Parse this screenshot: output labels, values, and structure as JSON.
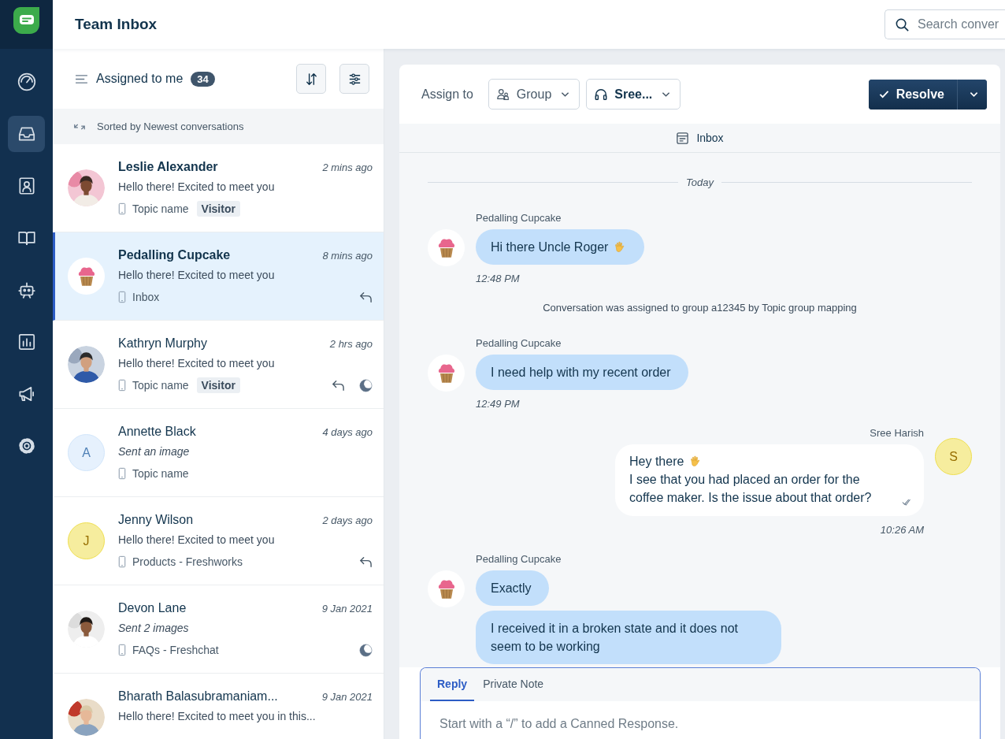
{
  "header": {
    "title": "Team Inbox",
    "search": {
      "placeholder": "Search conver"
    }
  },
  "nav": [
    {
      "selected": false
    },
    {
      "selected": true
    },
    {
      "selected": false
    },
    {
      "selected": false
    },
    {
      "selected": false
    },
    {
      "selected": false
    },
    {
      "selected": false
    },
    {
      "selected": false
    }
  ],
  "list": {
    "title": "Assigned to me",
    "count": "34",
    "sort_label": "Sorted by Newest conversations",
    "conversations": [
      {
        "name": "Leslie Alexander",
        "unread": true,
        "selected": false,
        "time": "2 mins ago",
        "preview": "Hello there! Excited to meet you",
        "preview_italic": false,
        "topic": "Topic name",
        "tag": "Visitor",
        "replied": false,
        "snoozed": false
      },
      {
        "name": "Pedalling Cupcake",
        "unread": true,
        "selected": true,
        "avatar": {
          "kind": "cupcake"
        },
        "time": "8 mins ago",
        "preview": "Hello there! Excited to meet you",
        "preview_italic": false,
        "topic": "Inbox",
        "replied": true,
        "snoozed": false
      },
      {
        "name": "Kathryn Murphy",
        "unread": false,
        "selected": false,
        "time": "2 hrs ago",
        "preview": "Hello there! Excited to meet you",
        "preview_italic": false,
        "topic": "Topic name",
        "tag": "Visitor",
        "replied": true,
        "snoozed": true
      },
      {
        "name": "Annette Black",
        "unread": false,
        "selected": false,
        "avatar": {
          "kind": "initial",
          "letter": "A",
          "color": "#e6f1fd"
        },
        "time": "4 days ago",
        "preview": "Sent an image",
        "preview_italic": true,
        "topic": "Topic name",
        "replied": false,
        "snoozed": false
      },
      {
        "name": "Jenny Wilson",
        "unread": false,
        "selected": false,
        "avatar": {
          "kind": "initial",
          "letter": "J",
          "color": "#f6ed9e"
        },
        "time": "2 days ago",
        "preview": "Hello there! Excited to meet you",
        "preview_italic": false,
        "topic": "Products - Freshworks",
        "replied": true,
        "snoozed": false
      },
      {
        "name": "Devon Lane",
        "unread": false,
        "selected": false,
        "time": "9 Jan 2021",
        "preview": "Sent 2 images",
        "preview_italic": true,
        "topic": "FAQs - Freshchat",
        "replied": false,
        "snoozed": true
      },
      {
        "name": "Bharath Balasubramaniam...",
        "unread": false,
        "selected": false,
        "time": "9 Jan 2021",
        "preview": "Hello there! Excited to meet you in this...",
        "preview_italic": false,
        "replied": false,
        "snoozed": false
      }
    ]
  },
  "chat": {
    "assign_label": "Assign to",
    "group": "Group",
    "agent": "Sree...",
    "resolve": "Resolve",
    "channel": "Inbox",
    "messages": [
      {
        "kind": "divider",
        "text": "Today"
      },
      {
        "kind": "incoming",
        "sender": "Pedalling Cupcake",
        "avatar": {
          "kind": "cupcake"
        },
        "bubbles": [
          {
            "text": "Hi there Uncle Roger",
            "wave": true
          }
        ],
        "time": "12:48 PM"
      },
      {
        "kind": "system",
        "text": "Conversation was assigned to group a12345 by Topic group mapping"
      },
      {
        "kind": "incoming",
        "sender": "Pedalling Cupcake",
        "avatar": {
          "kind": "cupcake"
        },
        "bubbles": [
          {
            "text": "I need help with my recent order",
            "wave": false
          }
        ],
        "time": "12:49 PM"
      },
      {
        "kind": "outgoing",
        "sender": "Sree Harish",
        "avatar": {
          "kind": "initial",
          "letter": "S",
          "color": "#f6ed9e"
        },
        "lines": [
          {
            "text": "Hey there",
            "wave": true
          },
          {
            "text": "I see that you had placed an order for the coffee maker. Is the issue about that order?",
            "wave": false
          }
        ],
        "read": true,
        "time": "10:26 AM"
      },
      {
        "kind": "incoming",
        "sender": "Pedalling Cupcake",
        "avatar": {
          "kind": "cupcake"
        },
        "bubbles": [
          {
            "text": "Exactly",
            "wave": false
          },
          {
            "text": "I received it in a broken state and it does not seem to be working",
            "wave": false
          }
        ]
      }
    ],
    "composer": {
      "tabs": [
        {
          "label": "Reply",
          "selected": true
        },
        {
          "label": "Private Note",
          "selected": false
        }
      ],
      "placeholder": "Start with a “/” to add a Canned Response."
    }
  }
}
